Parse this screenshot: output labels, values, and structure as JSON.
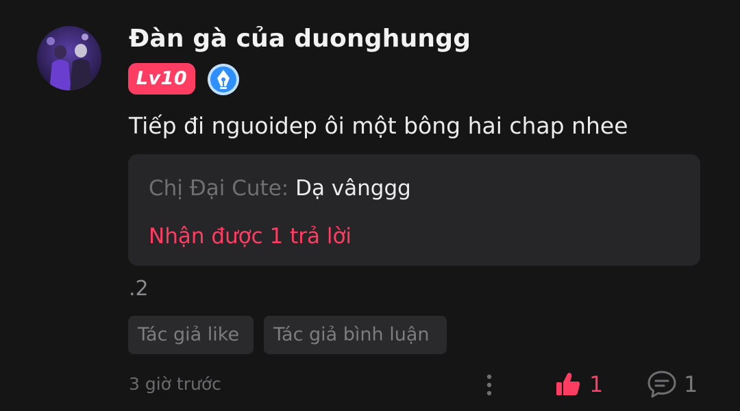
{
  "author": {
    "username": "Đàn gà của duonghungg",
    "level": "Lv10",
    "avatar": "user-avatar-photo",
    "badge_icon": "pen-nib-badge-icon"
  },
  "comment": {
    "text": "Tiếp đi nguoidep ôi một bông hai chap nhee",
    "extra": ".2"
  },
  "reply_preview": {
    "author": "Chị Đại Cute",
    "separator": ":",
    "content": " Dạ vânggg",
    "reply_count_text": "Nhận được 1 trả lời"
  },
  "tags": [
    "Tác giả like",
    "Tác giả bình luận"
  ],
  "footer": {
    "timestamp": "3 giờ trước",
    "more_icon": "more-vertical-icon",
    "like_icon": "thumbs-up-icon",
    "like_count": "1",
    "comment_icon": "comment-bubble-icon",
    "comment_count": "1"
  },
  "colors": {
    "background": "#151516",
    "accent": "#ff3d63",
    "panel": "#262628",
    "tag_bg": "#2a2a2c",
    "muted_text": "#6f6f72",
    "badge_blue": "#2f8fff"
  }
}
